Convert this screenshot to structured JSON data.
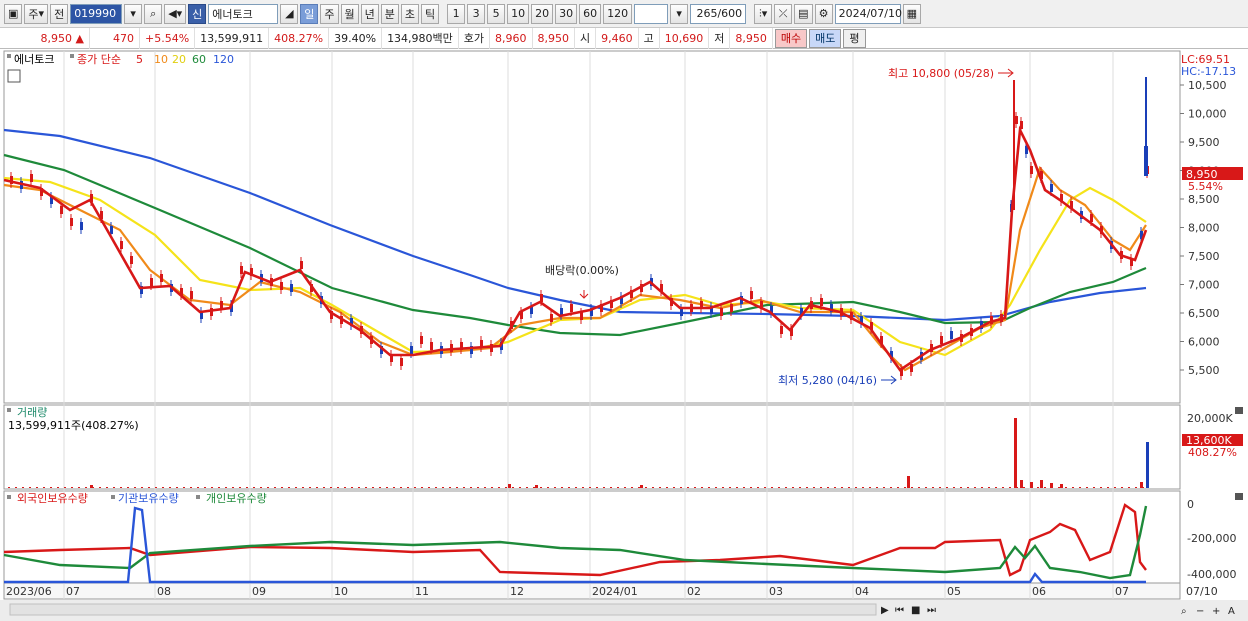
{
  "toolbar": {
    "market": "주",
    "prefix": "전",
    "code": "019990",
    "search_icon": "search-icon",
    "tag_new": "신",
    "stock_name": "에너토크",
    "periods": [
      "일",
      "주",
      "월",
      "년",
      "분",
      "초",
      "틱"
    ],
    "selected_period": "일",
    "intervals": [
      "1",
      "3",
      "5",
      "10",
      "20",
      "30",
      "60",
      "120"
    ],
    "count": "265/600",
    "date": "2024/07/10"
  },
  "info": {
    "price": "8,950",
    "change": "470",
    "change_pct": "+5.54%",
    "volume": "13,599,911",
    "volume_ratio": "408.27%",
    "turnover": "39.40%",
    "amount": "134,980백만",
    "quote_label": "호가",
    "quote_val": "8,960",
    "quote_val2": "8,950",
    "open_label": "시",
    "open_val": "9,460",
    "high_label": "고",
    "high_val": "10,690",
    "low_label": "저",
    "low_val": "8,950",
    "buy": "매수",
    "sell": "매도",
    "avg": "평"
  },
  "price_panel": {
    "name": "에너토크",
    "ma_label": "종가 단순",
    "ma_periods": [
      "5",
      "10",
      "20",
      "60",
      "120"
    ],
    "lc": "LC:69.51",
    "hc": "HC:-17.13",
    "high_note": "최고 10,800 (05/28)",
    "low_note": "최저 5,280 (04/16)",
    "div_note": "배당락(0.00%)",
    "cur_price": "8,950",
    "cur_pct": "5.54%",
    "yticks": [
      "10,500",
      "10,000",
      "9,500",
      "9,000",
      "8,500",
      "8,000",
      "7,500",
      "7,000",
      "6,500",
      "6,000",
      "5,500"
    ]
  },
  "volume_panel": {
    "title": "거래량",
    "value": "13,599,911주(408.27%)",
    "ytick": "20,000K",
    "cur": "13,600K",
    "cur_pct": "408.27%"
  },
  "holding_panel": {
    "s1": "외국인보유수량",
    "s2": "기관보유수량",
    "s3": "개인보유수량",
    "yticks": [
      "0",
      "-200,000",
      "-400,000"
    ]
  },
  "xaxis": [
    "2023/06",
    "07",
    "08",
    "09",
    "10",
    "11",
    "12",
    "2024/01",
    "02",
    "03",
    "04",
    "05",
    "06",
    "07",
    "07/10"
  ],
  "colors": {
    "ma5": "#d81818",
    "ma10": "#f08a1a",
    "ma20": "#f5e31a",
    "ma60": "#1e8a3a",
    "ma120": "#2a56d8",
    "up": "#d81818",
    "down": "#1a3fb8"
  }
}
